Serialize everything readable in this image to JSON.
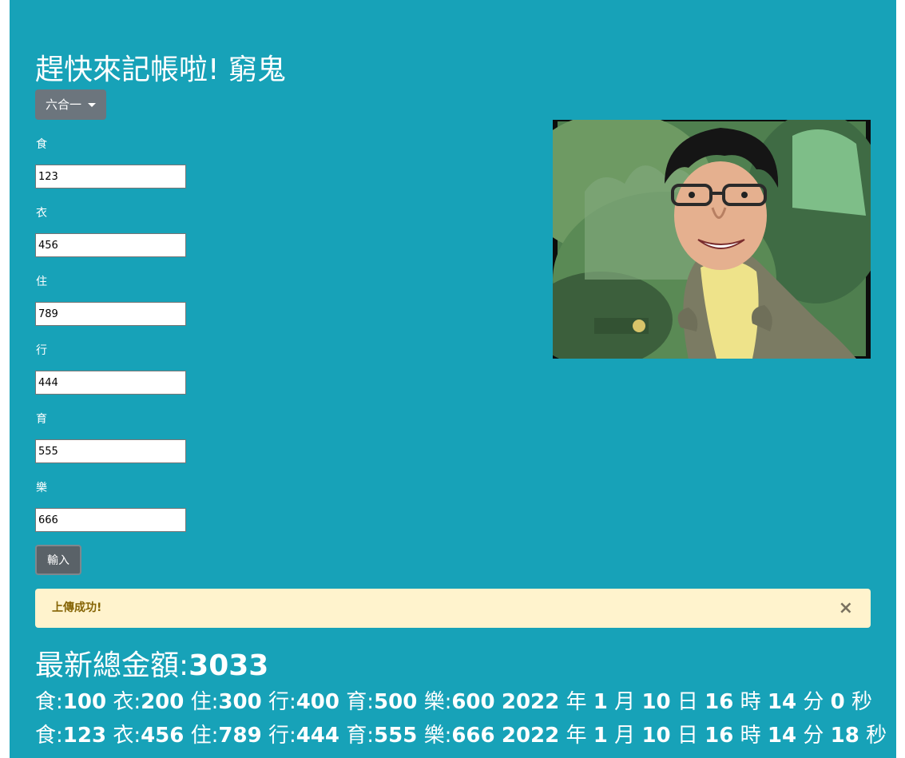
{
  "header": {
    "title": "趕快來記帳啦! 窮鬼"
  },
  "dropdown": {
    "label": "六合一"
  },
  "form": {
    "fields": [
      {
        "label": "食",
        "value": "123"
      },
      {
        "label": "衣",
        "value": "456"
      },
      {
        "label": "住",
        "value": "789"
      },
      {
        "label": "行",
        "value": "444"
      },
      {
        "label": "育",
        "value": "555"
      },
      {
        "label": "樂",
        "value": "666"
      }
    ],
    "submit_label": "輸入"
  },
  "alert": {
    "message": "上傳成功!",
    "close_symbol": "×"
  },
  "summary": {
    "total_label": "最新總金額:",
    "total_value": "3033"
  },
  "records": [
    {
      "items": [
        {
          "k": "食:",
          "v": "100"
        },
        {
          "k": "衣:",
          "v": "200"
        },
        {
          "k": "住:",
          "v": "300"
        },
        {
          "k": "行:",
          "v": "400"
        },
        {
          "k": "育:",
          "v": "500"
        },
        {
          "k": "樂:",
          "v": "600"
        }
      ],
      "year": "2022",
      "month": "1",
      "day": "10",
      "hour": "16",
      "minute": "14",
      "second": "0"
    },
    {
      "items": [
        {
          "k": "食:",
          "v": "123"
        },
        {
          "k": "衣:",
          "v": "456"
        },
        {
          "k": "住:",
          "v": "789"
        },
        {
          "k": "行:",
          "v": "444"
        },
        {
          "k": "育:",
          "v": "555"
        },
        {
          "k": "樂:",
          "v": "666"
        }
      ],
      "year": "2022",
      "month": "1",
      "day": "10",
      "hour": "16",
      "minute": "14",
      "second": "18"
    }
  ],
  "date_units": {
    "year": "年",
    "month": "月",
    "day": "日",
    "hour": "時",
    "minute": "分",
    "second": "秒"
  },
  "colors": {
    "panel_bg": "#17a2b8",
    "alert_bg": "#fff3cd",
    "alert_text": "#856404",
    "secondary_button": "#6c757d"
  }
}
